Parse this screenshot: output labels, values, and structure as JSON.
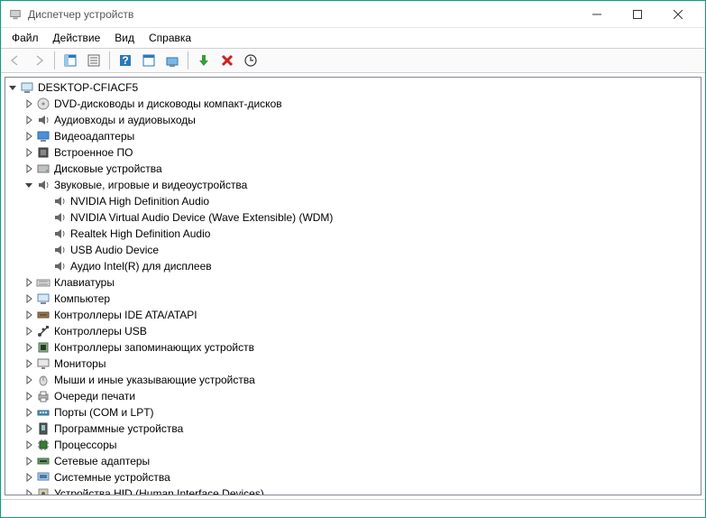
{
  "window": {
    "title": "Диспетчер устройств"
  },
  "menu": {
    "file": "Файл",
    "action": "Действие",
    "view": "Вид",
    "help": "Справка"
  },
  "tree": {
    "root": {
      "label": "DESKTOP-CFIACF5",
      "icon": "computer",
      "expanded": true,
      "children": [
        {
          "label": "DVD-дисководы и дисководы компакт-дисков",
          "icon": "optical",
          "expanded": false
        },
        {
          "label": "Аудиовходы и аудиовыходы",
          "icon": "audio",
          "expanded": false
        },
        {
          "label": "Видеоадаптеры",
          "icon": "display",
          "expanded": false
        },
        {
          "label": "Встроенное ПО",
          "icon": "firmware",
          "expanded": false
        },
        {
          "label": "Дисковые устройства",
          "icon": "disk",
          "expanded": false
        },
        {
          "label": "Звуковые, игровые и видеоустройства",
          "icon": "audio",
          "expanded": true,
          "children": [
            {
              "label": "NVIDIA High Definition Audio",
              "icon": "audio"
            },
            {
              "label": "NVIDIA Virtual Audio Device (Wave Extensible) (WDM)",
              "icon": "audio"
            },
            {
              "label": "Realtek High Definition Audio",
              "icon": "audio"
            },
            {
              "label": "USB Audio Device",
              "icon": "audio"
            },
            {
              "label": "Аудио Intel(R) для дисплеев",
              "icon": "audio"
            }
          ]
        },
        {
          "label": "Клавиатуры",
          "icon": "keyboard",
          "expanded": false
        },
        {
          "label": "Компьютер",
          "icon": "computer",
          "expanded": false
        },
        {
          "label": "Контроллеры IDE ATA/ATAPI",
          "icon": "ide",
          "expanded": false
        },
        {
          "label": "Контроллеры USB",
          "icon": "usb",
          "expanded": false
        },
        {
          "label": "Контроллеры запоминающих устройств",
          "icon": "storage",
          "expanded": false
        },
        {
          "label": "Мониторы",
          "icon": "monitor",
          "expanded": false
        },
        {
          "label": "Мыши и иные указывающие устройства",
          "icon": "mouse",
          "expanded": false
        },
        {
          "label": "Очереди печати",
          "icon": "printer",
          "expanded": false
        },
        {
          "label": "Порты (COM и LPT)",
          "icon": "port",
          "expanded": false
        },
        {
          "label": "Программные устройства",
          "icon": "software",
          "expanded": false
        },
        {
          "label": "Процессоры",
          "icon": "cpu",
          "expanded": false
        },
        {
          "label": "Сетевые адаптеры",
          "icon": "network",
          "expanded": false
        },
        {
          "label": "Системные устройства",
          "icon": "system",
          "expanded": false
        },
        {
          "label": "Устройства HID (Human Interface Devices)",
          "icon": "hid",
          "expanded": false
        }
      ]
    }
  }
}
